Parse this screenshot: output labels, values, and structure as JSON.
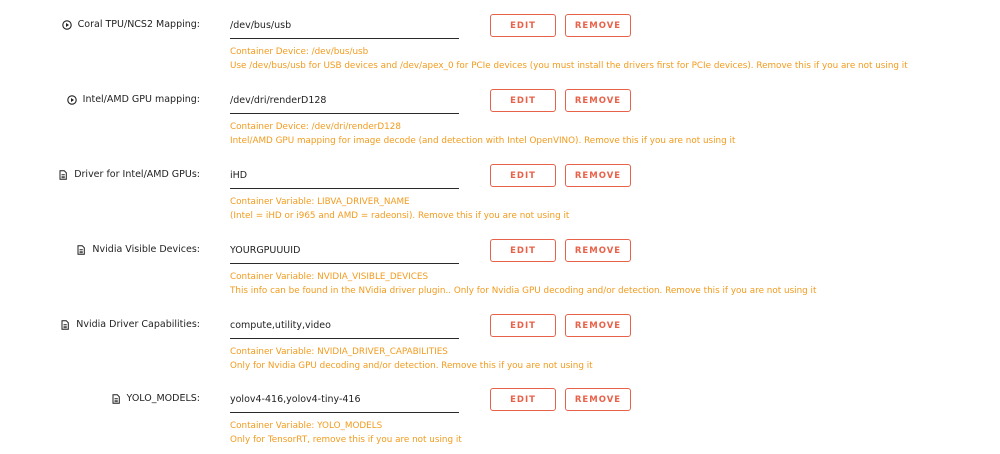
{
  "rows": [
    {
      "label": "Coral TPU/NCS2 Mapping:",
      "icon": "play-circle-icon",
      "value": "/dev/bus/usb",
      "edit_label": "EDIT",
      "remove_label": "REMOVE",
      "desc_line1": "Container Device: /dev/bus/usb",
      "desc_line2": "Use /dev/bus/usb for USB devices and /dev/apex_0 for PCIe devices (you must install the drivers first for PCIe devices). Remove this if you are not using it"
    },
    {
      "label": "Intel/AMD GPU mapping:",
      "icon": "play-circle-icon",
      "value": "/dev/dri/renderD128",
      "edit_label": "EDIT",
      "remove_label": "REMOVE",
      "desc_line1": "Container Device: /dev/dri/renderD128",
      "desc_line2": "Intel/AMD GPU mapping for image decode (and detection with Intel OpenVINO). Remove this if you are not using it"
    },
    {
      "label": "Driver for Intel/AMD GPUs:",
      "icon": "document-icon",
      "value": "iHD",
      "edit_label": "EDIT",
      "remove_label": "REMOVE",
      "desc_line1": "Container Variable: LIBVA_DRIVER_NAME",
      "desc_line2": "(Intel = iHD or i965 and AMD = radeonsi). Remove this if you are not using it"
    },
    {
      "label": "Nvidia Visible Devices:",
      "icon": "document-icon",
      "value": "YOURGPUUUID",
      "edit_label": "EDIT",
      "remove_label": "REMOVE",
      "desc_line1": "Container Variable: NVIDIA_VISIBLE_DEVICES",
      "desc_line2": "This info can be found in the NVidia driver plugin.. Only for Nvidia GPU decoding and/or detection. Remove this if you are not using it"
    },
    {
      "label": "Nvidia Driver Capabilities:",
      "icon": "document-icon",
      "value": "compute,utility,video",
      "edit_label": "EDIT",
      "remove_label": "REMOVE",
      "desc_line1": "Container Variable: NVIDIA_DRIVER_CAPABILITIES",
      "desc_line2": "Only for Nvidia GPU decoding and/or detection. Remove this if you are not using it"
    },
    {
      "label": "YOLO_MODELS:",
      "icon": "document-icon",
      "value": "yolov4-416,yolov4-tiny-416",
      "edit_label": "EDIT",
      "remove_label": "REMOVE",
      "desc_line1": "Container Variable: YOLO_MODELS",
      "desc_line2": "Only for TensorRT, remove this if you are not using it"
    }
  ],
  "colors": {
    "accent": "#e8624a",
    "description": "#f29b1d",
    "text": "#1f1f1f"
  }
}
